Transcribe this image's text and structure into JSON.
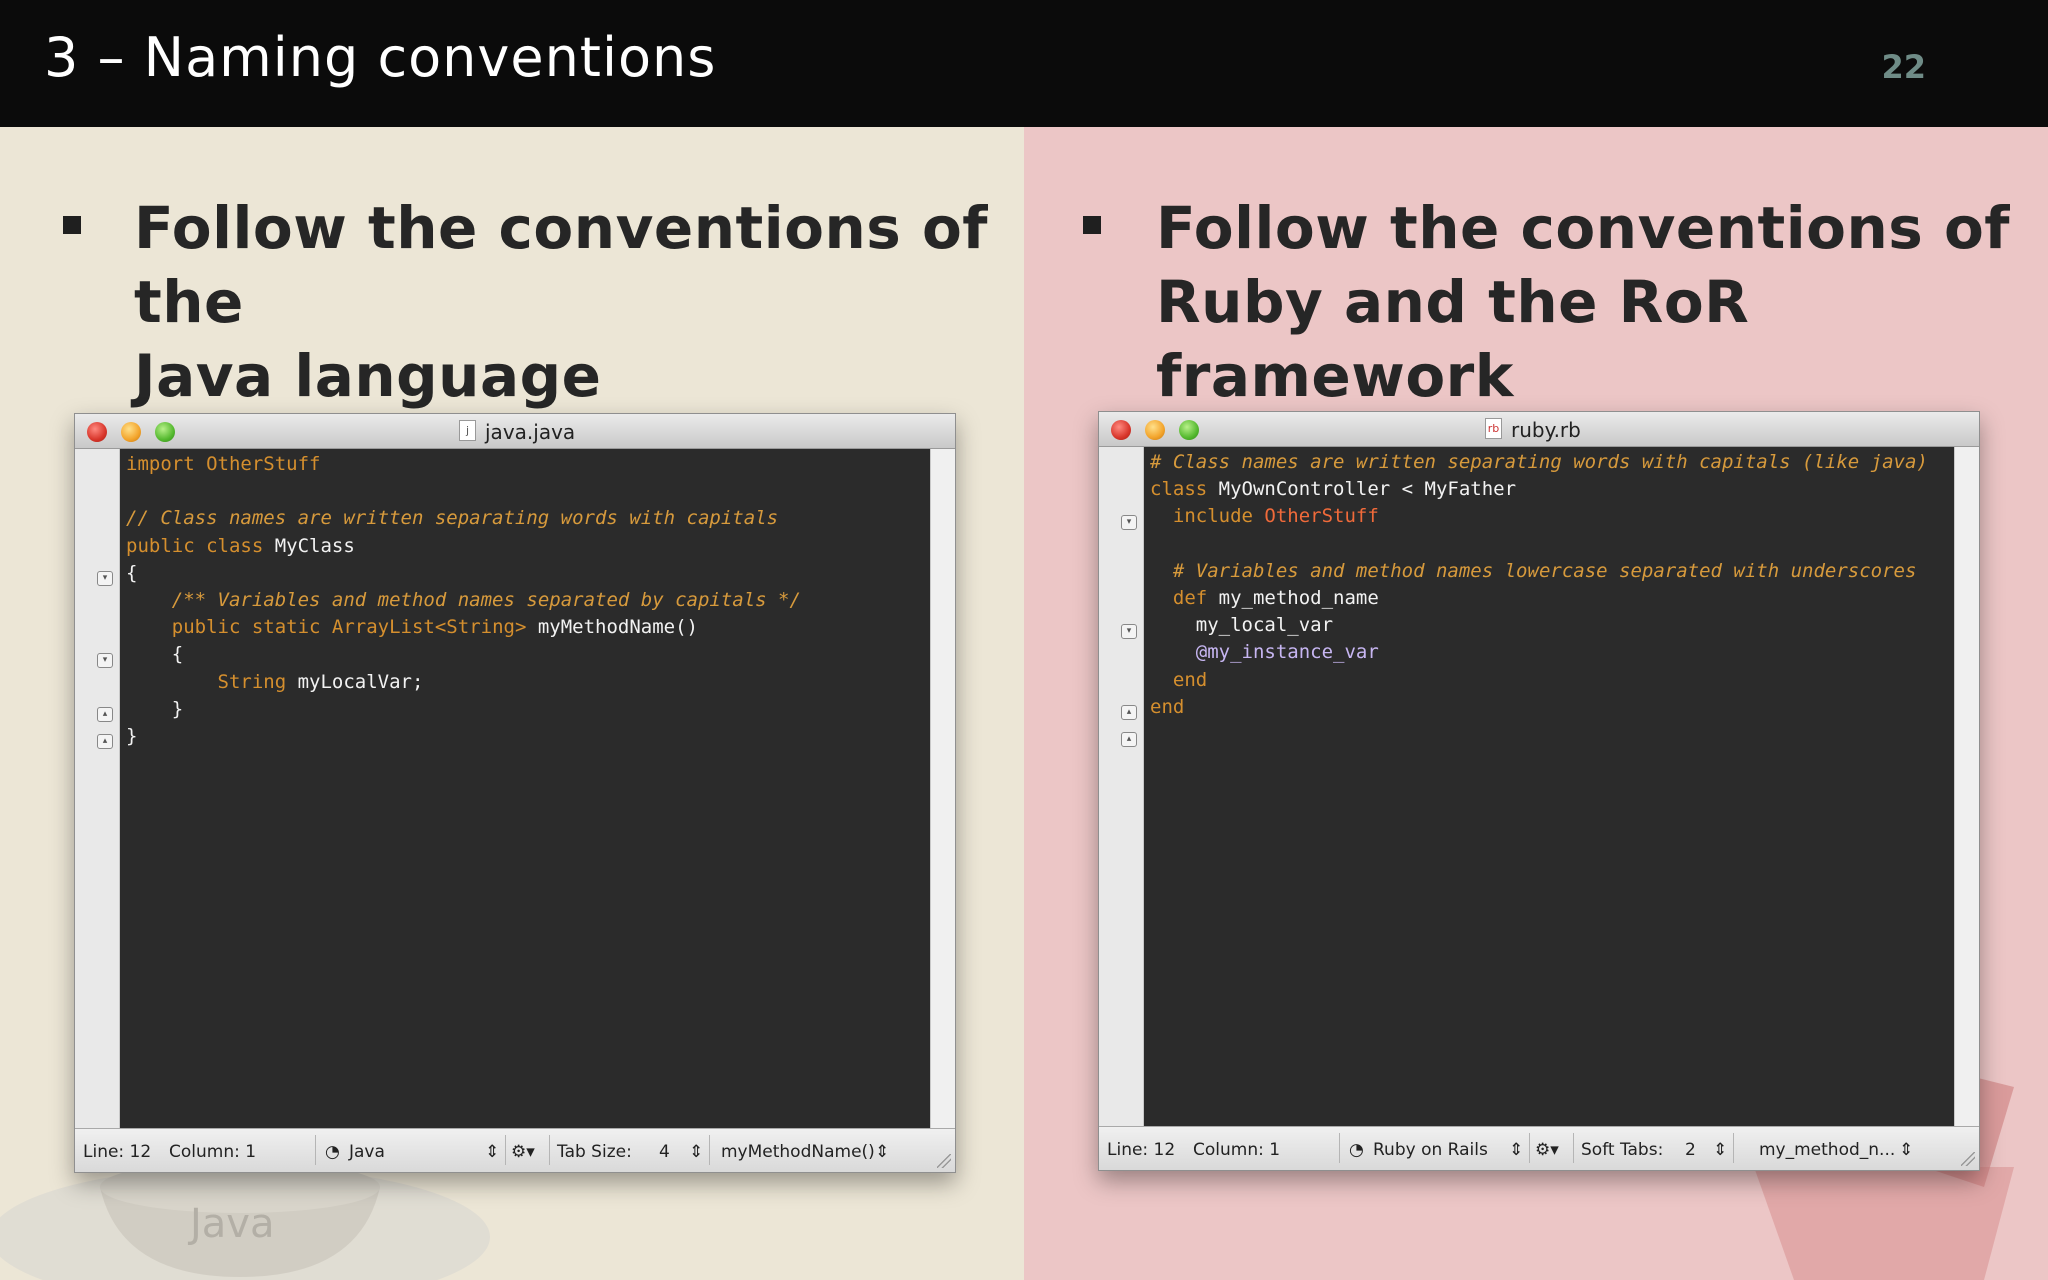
{
  "slide": {
    "title": "3 – Naming conventions",
    "page_number": "22"
  },
  "left": {
    "bullet_line1": "Follow the conventions of the",
    "bullet_line2": "Java language",
    "watermark": "Java",
    "window": {
      "title": "java.java",
      "file_icon": "j",
      "status": {
        "line": "Line: 12",
        "column": "Column: 1",
        "language": "Java",
        "tab_label": "Tab Size:",
        "tab_value": "4",
        "symbol": "myMethodName()"
      }
    }
  },
  "right": {
    "bullet_line1": "Follow the conventions of",
    "bullet_line2": "Ruby and the RoR framework",
    "window": {
      "title": "ruby.rb",
      "file_icon": "rb",
      "status": {
        "line": "Line: 12",
        "column": "Column: 1",
        "language": "Ruby on Rails",
        "tab_label": "Soft Tabs:",
        "tab_value": "2",
        "symbol": "my_method_n..."
      }
    }
  },
  "java_code": {
    "l1": "import OtherStuff",
    "l3": "// Class names are written separating words with capitals",
    "l4a": "public class ",
    "l4b": "MyClass",
    "l5": "{",
    "l6": "/** Variables and method names separated by capitals */",
    "l7a": "public static ",
    "l7b": "ArrayList<String>",
    "l7c": " myMethodName()",
    "l8": "{",
    "l9a": "String ",
    "l9b": "myLocalVar;",
    "l10": "}",
    "l11": "}"
  },
  "ruby_code": {
    "l2": "# Class names are written separating words with capitals (like java)",
    "l3a": "class ",
    "l3b": "MyOwnController < MyFather",
    "l4a": "include ",
    "l4b": "OtherStuff",
    "l6": "# Variables and method names lowercase separated with underscores",
    "l7a": "def ",
    "l7b": "my_method_name",
    "l8": "my_local_var",
    "l9": "@my_instance_var",
    "l10": "end",
    "l11": "end"
  },
  "colors": {
    "comment": "#d79a3c",
    "keyword": "#d58f2e",
    "string_class": "#f06a3a",
    "ivar": "#c7b6f2",
    "editor_bg": "#2b2b2b"
  },
  "icons": [
    "close-traffic-light",
    "minimize-traffic-light",
    "zoom-traffic-light",
    "fold-marker",
    "language-icon",
    "gear-icon",
    "resize-grip-icon"
  ]
}
